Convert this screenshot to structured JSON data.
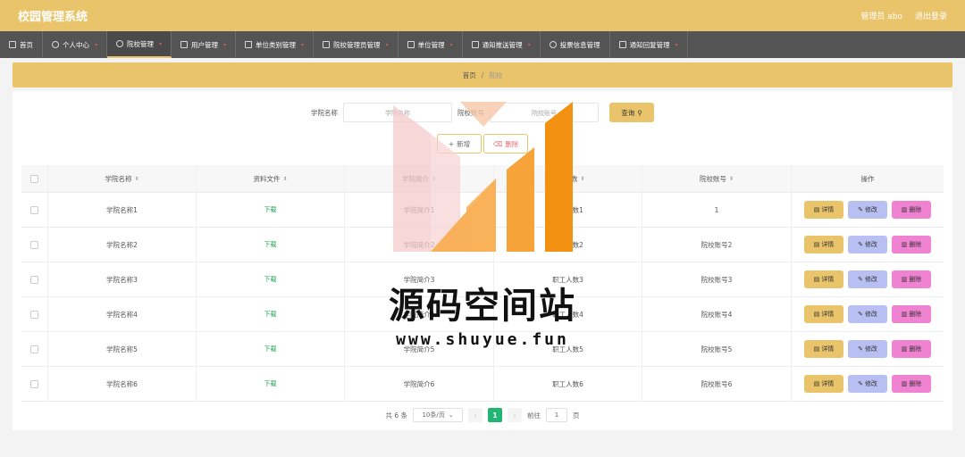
{
  "header": {
    "title": "校园管理系统",
    "admin": "管理员 abo",
    "logout": "退出登录"
  },
  "nav": [
    {
      "label": "首页",
      "icon": "home-icon",
      "caret": false,
      "active": false
    },
    {
      "label": "个人中心",
      "icon": "user-icon",
      "caret": true,
      "active": false
    },
    {
      "label": "院校管理",
      "icon": "gauge-icon",
      "caret": true,
      "active": true
    },
    {
      "label": "用户管理",
      "icon": "chat-icon",
      "caret": true,
      "active": false
    },
    {
      "label": "单位类别管理",
      "icon": "bar-chart-icon",
      "caret": true,
      "active": false
    },
    {
      "label": "院校管理员管理",
      "icon": "columns-icon",
      "caret": true,
      "active": false
    },
    {
      "label": "单位管理",
      "icon": "monitor-icon",
      "caret": true,
      "active": false
    },
    {
      "label": "通知推送管理",
      "icon": "image-icon",
      "caret": true,
      "active": false
    },
    {
      "label": "投票信息管理",
      "icon": "compass-icon",
      "caret": false,
      "active": false
    },
    {
      "label": "通知回复管理",
      "icon": "file-icon",
      "caret": true,
      "active": false
    }
  ],
  "breadcrumb": {
    "home": "首页",
    "sep": "/",
    "current": "院校"
  },
  "search": {
    "label1": "学院名称",
    "placeholder1": "学院名称",
    "label2": "院校账号",
    "placeholder2": "院校账号",
    "query_btn": "查询"
  },
  "actions": {
    "add": "新增",
    "delete": "删除"
  },
  "table": {
    "columns": [
      "学院名称",
      "资料文件",
      "学院简介",
      "职工人数",
      "院校账号",
      "操作"
    ],
    "rows": [
      {
        "name": "学院名称1",
        "file": "下载",
        "intro": "学院简介1",
        "staff": "职工人数1",
        "account": "1"
      },
      {
        "name": "学院名称2",
        "file": "下载",
        "intro": "学院简介2",
        "staff": "职工人数2",
        "account": "院校账号2"
      },
      {
        "name": "学院名称3",
        "file": "下载",
        "intro": "学院简介3",
        "staff": "职工人数3",
        "account": "院校账号3"
      },
      {
        "name": "学院名称4",
        "file": "下载",
        "intro": "学院简介4",
        "staff": "职工人数4",
        "account": "院校账号4"
      },
      {
        "name": "学院名称5",
        "file": "下载",
        "intro": "学院简介5",
        "staff": "职工人数5",
        "account": "院校账号5"
      },
      {
        "name": "学院名称6",
        "file": "下载",
        "intro": "学院简介6",
        "staff": "职工人数6",
        "account": "院校账号6"
      }
    ],
    "ops": {
      "detail": "详情",
      "edit": "修改",
      "remove": "删除"
    }
  },
  "pagination": {
    "total": "共 6 条",
    "page_size": "10条/页",
    "current": "1",
    "goto": "前往",
    "goto_value": "1",
    "page_unit": "页"
  },
  "watermark": {
    "title": "源码空间站",
    "url": "www.shuyue.fun"
  },
  "colors": {
    "primary": "#e9c46a",
    "nav": "#545454",
    "edit": "#b8bff2",
    "remove": "#f082d2",
    "page_active": "#22b573"
  }
}
